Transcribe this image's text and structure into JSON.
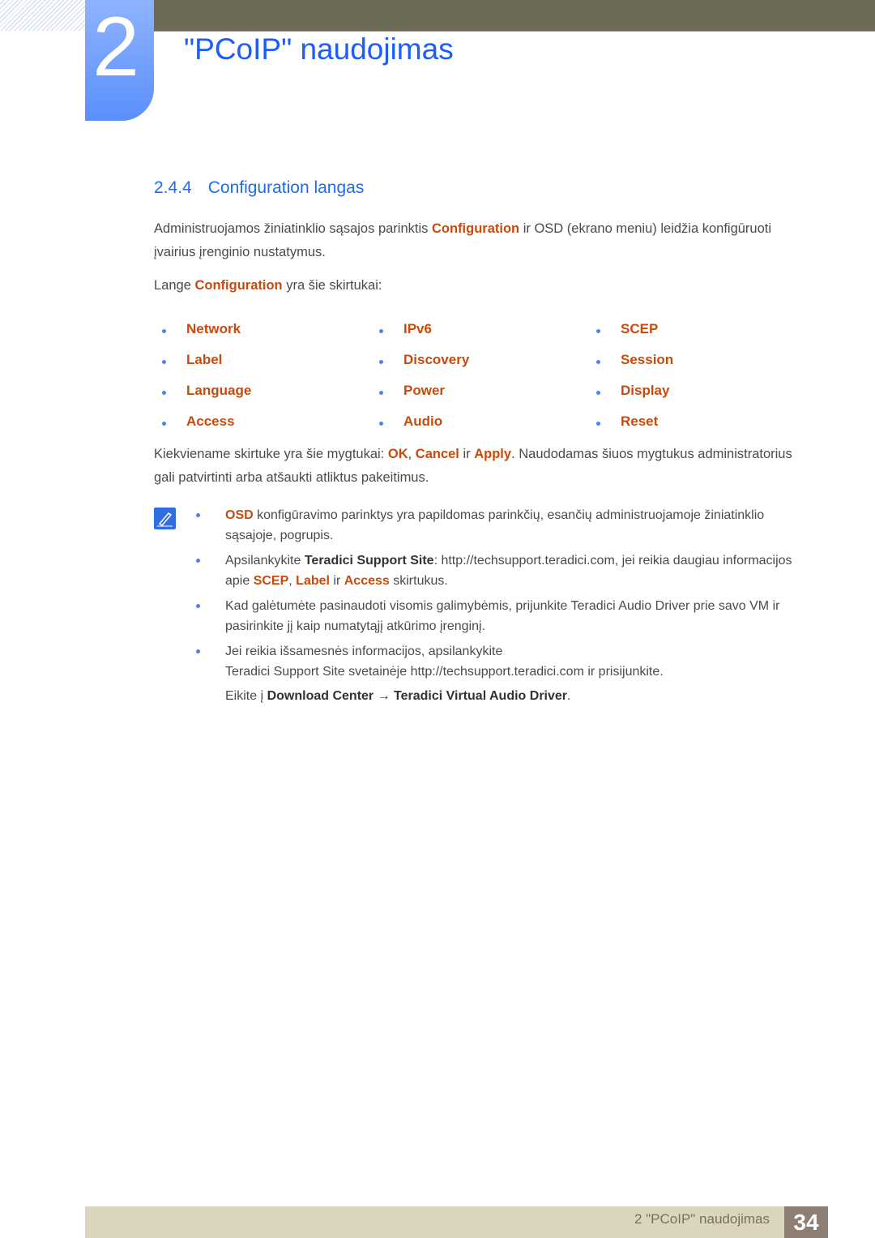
{
  "header": {
    "chapter_number": "2",
    "chapter_title": "\"PCoIP\" naudojimas"
  },
  "section": {
    "number": "2.4.4",
    "title": "Configuration langas"
  },
  "intro": {
    "a": "Administruojamos žiniatinklio sąsajos parinktis ",
    "b": "Configuration",
    "c": " ir OSD (ekrano meniu) leidžia konfigūruoti įvairius įrenginio nustatymus."
  },
  "tabs_intro": {
    "a": "Lange ",
    "b": "Configuration",
    "c": " yra šie skirtukai:"
  },
  "tabs": [
    [
      "Network",
      "Label",
      "Language",
      "Access"
    ],
    [
      "IPv6",
      "Discovery",
      "Power",
      "Audio"
    ],
    [
      "SCEP",
      "Session",
      "Display",
      "Reset"
    ]
  ],
  "buttons_para": {
    "a": "Kiekviename skirtuke yra šie mygtukai: ",
    "ok": "OK",
    "s1": ", ",
    "cancel": "Cancel",
    "s2": " ir ",
    "apply": "Apply",
    "c": ". Naudodamas šiuos mygtukus administratorius gali patvirtinti arba atšaukti atliktus pakeitimus."
  },
  "notes": {
    "n1": {
      "a": "OSD",
      "b": " konfigūravimo parinktys yra papildomas parinkčių, esančių administruojamoje žiniatinklio sąsajoje, pogrupis."
    },
    "n2": {
      "a": "Apsilankykite ",
      "b": "Teradici Support Site",
      "c": ": http://techsupport.teradici.com, jei reikia daugiau informacijos apie ",
      "d": "SCEP",
      "e": ", ",
      "f": "Label",
      "g": " ir ",
      "h": "Access",
      "i": " skirtukus."
    },
    "n3": {
      "a": "Kad galėtumėte pasinaudoti visomis galimybėmis, prijunkite Teradici Audio Driver prie savo VM ir pasirinkite jį kaip numatytąjį atkūrimo įrenginį."
    },
    "n4": {
      "a": "Jei reikia išsamesnės informacijos, apsilankykite",
      "b": "Teradici Support Site svetainėje http://techsupport.teradici.com ir prisijunkite.",
      "c": "Eikite į ",
      "d": "Download Center",
      "e": " → ",
      "f": "Teradici Virtual Audio Driver",
      "g": "."
    }
  },
  "footer": {
    "text": "2 \"PCoIP\" naudojimas",
    "page": "34"
  }
}
